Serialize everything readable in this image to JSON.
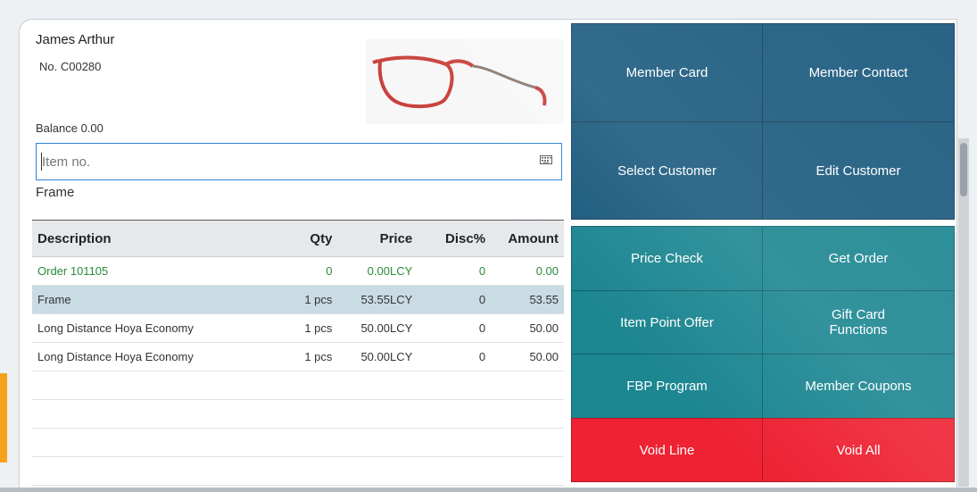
{
  "customer": {
    "name": "James Arthur",
    "number": "No.  C00280",
    "balance": "Balance 0.00",
    "category": "Frame"
  },
  "item_input": {
    "placeholder": "Item no.",
    "value": ""
  },
  "table": {
    "headers": {
      "description": "Description",
      "qty": "Qty",
      "price": "Price",
      "disc": "Disc%",
      "amount": "Amount"
    },
    "rows": [
      {
        "description": "Order 101105",
        "qty": "0",
        "price": "0.00LCY",
        "disc": "0",
        "amount": "0.00"
      },
      {
        "description": "Frame",
        "qty": "1 pcs",
        "price": "53.55LCY",
        "disc": "0",
        "amount": "53.55"
      },
      {
        "description": "Long Distance Hoya Economy",
        "qty": "1 pcs",
        "price": "50.00LCY",
        "disc": "0",
        "amount": "50.00"
      },
      {
        "description": "Long Distance Hoya Economy",
        "qty": "1 pcs",
        "price": "50.00LCY",
        "disc": "0",
        "amount": "50.00"
      }
    ]
  },
  "buttons": {
    "member_card": "Member Card",
    "member_contact": "Member Contact",
    "select_customer": "Select Customer",
    "edit_customer": "Edit Customer",
    "price_check": "Price Check",
    "get_order": "Get Order",
    "item_point_offer": "Item Point Offer",
    "gift_card_functions": "Gift Card\nFunctions",
    "fbp_program": "FBP Program",
    "member_coupons": "Member Coupons",
    "void_line": "Void Line",
    "void_all": "Void All"
  },
  "colors": {
    "navy": "#1b5a7e",
    "teal": "#1c8691",
    "red": "#ee2233",
    "order_green": "#2a8a3a",
    "selected_row": "#c9dbe3"
  },
  "icons": {
    "keyboard": "keyboard-icon",
    "product_image": "eyeglasses-frame"
  }
}
